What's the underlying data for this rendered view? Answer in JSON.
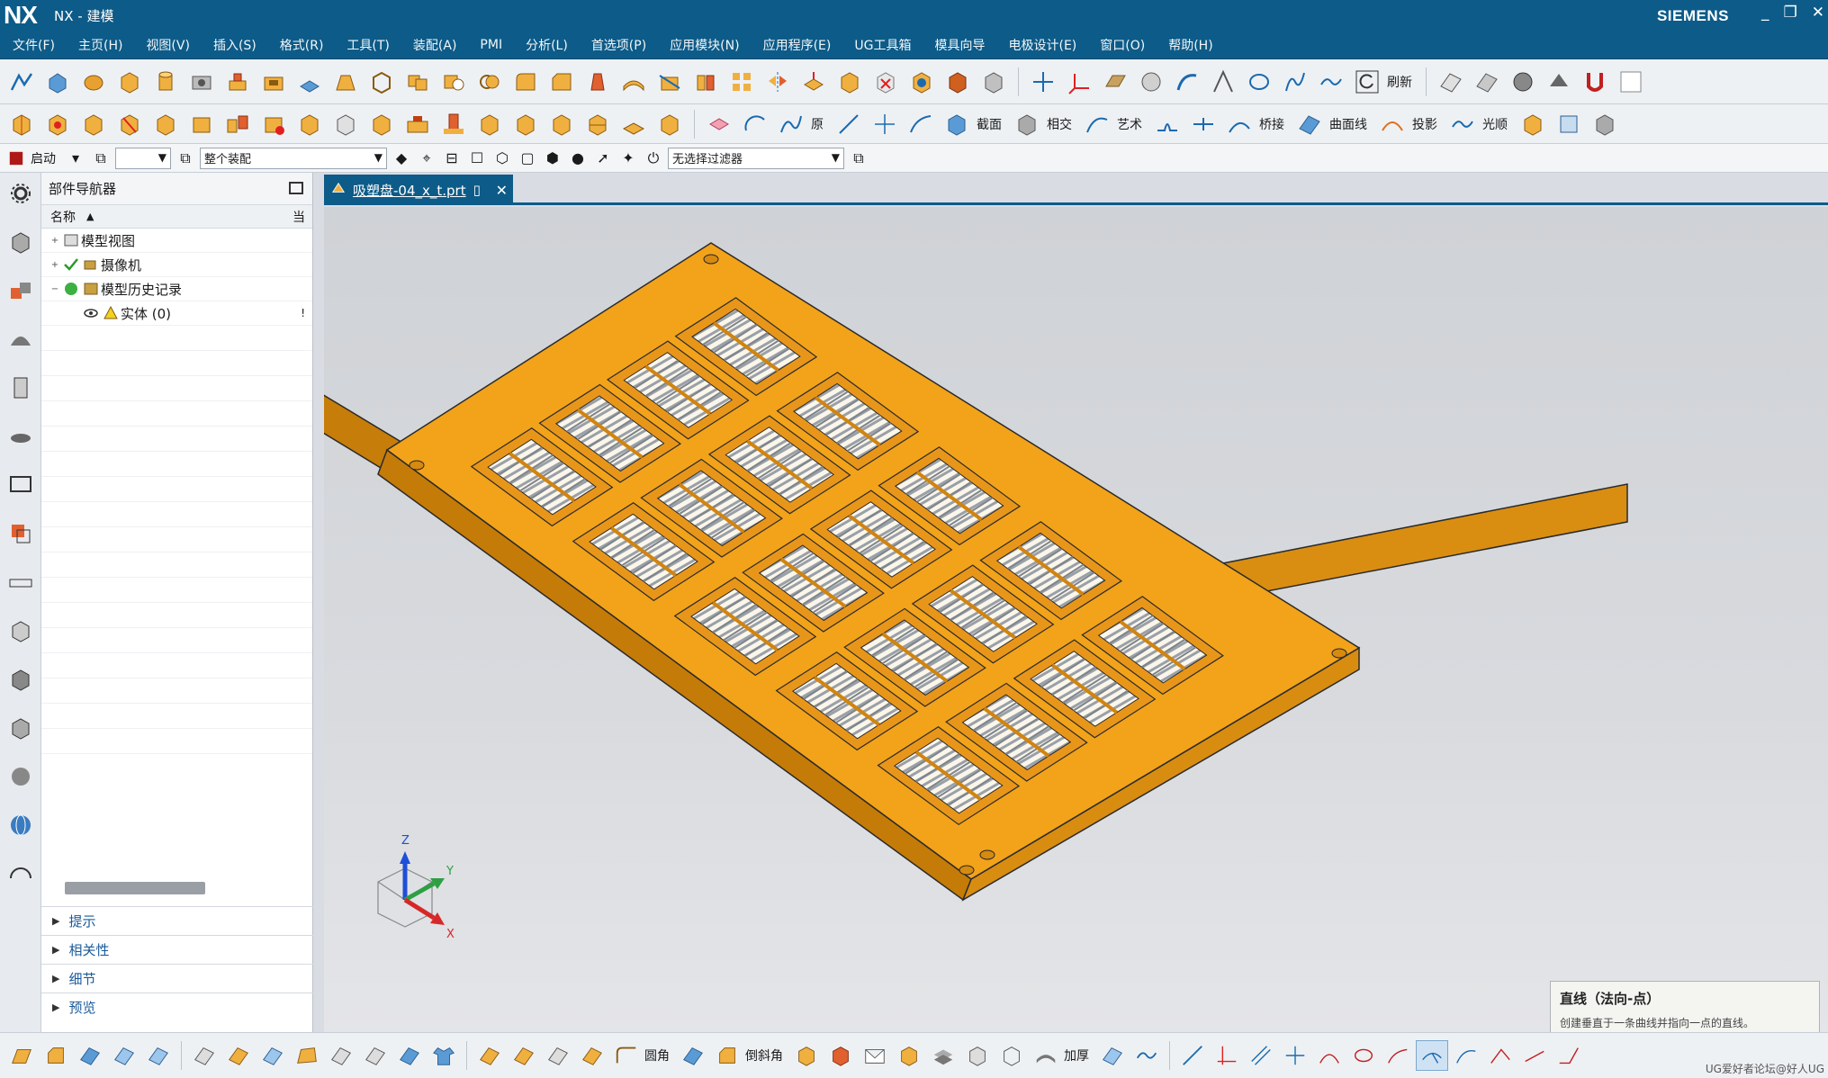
{
  "titlebar": {
    "logo": "NX",
    "title": "NX - 建模",
    "brand": "SIEMENS",
    "min": "_",
    "restore": "❐",
    "close": "✕"
  },
  "menubar": {
    "items": [
      "文件(F)",
      "主页(H)",
      "视图(V)",
      "插入(S)",
      "格式(R)",
      "工具(T)",
      "装配(A)",
      "PMI",
      "分析(L)",
      "首选项(P)",
      "应用模块(N)",
      "应用程序(E)",
      "UG工具箱",
      "模具向导",
      "电极设计(E)",
      "窗口(O)",
      "帮助(H)"
    ]
  },
  "toolbar2": {
    "labels": [
      "原",
      "截面",
      "相交",
      "艺术",
      "桥接",
      "曲面线",
      "投影",
      "光顺"
    ]
  },
  "toolbar1": {
    "labels": [
      "刷新"
    ]
  },
  "toolbar3": {
    "start": "启动",
    "assembly_filter": "整个装配",
    "selection_filter": "无选择过滤器",
    "layer_value": ""
  },
  "navigator": {
    "title": "部件导航器",
    "column_name": "名称",
    "sort_icon": "▲",
    "col_extra": "当",
    "items": [
      {
        "label": "模型视图",
        "expander": "+",
        "indent": 0,
        "icon": "view-icon",
        "tag": ""
      },
      {
        "label": "摄像机",
        "expander": "+",
        "indent": 0,
        "icon": "camera-icon",
        "tag": ""
      },
      {
        "label": "模型历史记录",
        "expander": "−",
        "indent": 0,
        "icon": "history-icon",
        "tag": ""
      },
      {
        "label": "实体 (0)",
        "expander": "",
        "indent": 1,
        "icon": "solid-body-icon",
        "tag": "!"
      }
    ],
    "sections": [
      "提示",
      "相关性",
      "细节",
      "预览"
    ]
  },
  "tab": {
    "name": "吸塑盘-04_x_t.prt",
    "close": "✕"
  },
  "tooltip": {
    "title": "直线（法向-点）",
    "description": "创建垂直于一条曲线并指向一点的直线。"
  },
  "bottombar": {
    "labels": [
      "圆角",
      "倒斜角",
      "加厚"
    ]
  },
  "watermark": "UG爱好者论坛@好人UG",
  "colors": {
    "accent": "#0d5b88",
    "part": "#f0a020",
    "viewport": "#d6d8dc"
  }
}
